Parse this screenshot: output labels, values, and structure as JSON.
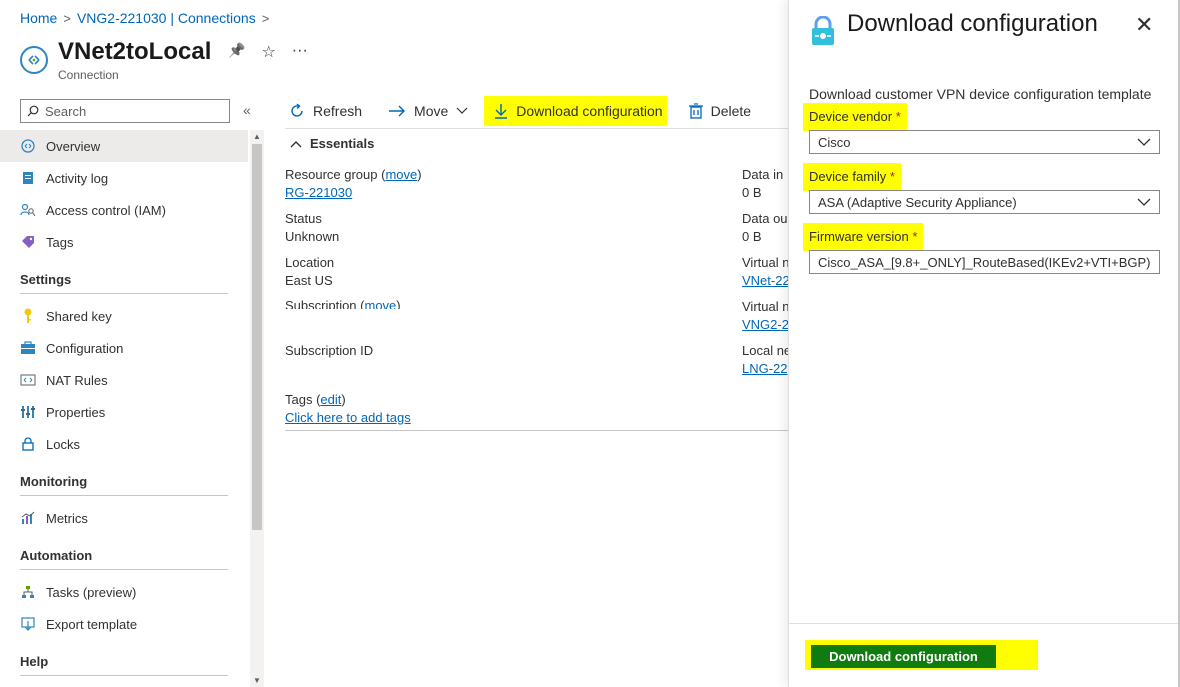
{
  "breadcrumb": {
    "home": "Home",
    "gateway": "VNG2-221030 | Connections",
    "sep": ">"
  },
  "header": {
    "title": "VNet2toLocal",
    "subtitle": "Connection",
    "pin": "📌",
    "star": "☆",
    "more": "···"
  },
  "search": {
    "placeholder": "Search",
    "collapse": "«"
  },
  "sidebar": {
    "items": [
      {
        "label": "Overview"
      },
      {
        "label": "Activity log"
      },
      {
        "label": "Access control (IAM)"
      },
      {
        "label": "Tags"
      }
    ],
    "settings": {
      "heading": "Settings",
      "items": [
        {
          "label": "Shared key"
        },
        {
          "label": "Configuration"
        },
        {
          "label": "NAT Rules"
        },
        {
          "label": "Properties"
        },
        {
          "label": "Locks"
        }
      ]
    },
    "monitoring": {
      "heading": "Monitoring",
      "items": [
        {
          "label": "Metrics"
        }
      ]
    },
    "automation": {
      "heading": "Automation",
      "items": [
        {
          "label": "Tasks (preview)"
        },
        {
          "label": "Export template"
        }
      ]
    },
    "help": {
      "heading": "Help"
    }
  },
  "toolbar": {
    "refresh": "Refresh",
    "move": "Move",
    "download": "Download configuration",
    "delete": "Delete"
  },
  "essentials": {
    "heading": "Essentials",
    "resource_group_label": "Resource group",
    "move_link": "move",
    "resource_group_value": "RG-221030",
    "status_label": "Status",
    "status_value": "Unknown",
    "location_label": "Location",
    "location_value": "East US",
    "subscription_label": "Subscription",
    "subscription_id_label": "Subscription ID",
    "tags_label": "Tags",
    "edit_link": "edit",
    "tags_add": "Click here to add tags",
    "data_in_label": "Data in",
    "data_in_value": "0 B",
    "data_out_label": "Data ou",
    "data_out_value": "0 B",
    "vnet_label": "Virtual n",
    "vnet_value": "VNet-22",
    "vng_label": "Virtual n",
    "vng_value": "VNG2-2",
    "lng_label": "Local ne",
    "lng_value": "LNG-22"
  },
  "panel": {
    "title": "Download configuration",
    "close": "✕",
    "description": "Download customer VPN device configuration template",
    "vendor_label": "Device vendor",
    "vendor_value": "Cisco",
    "family_label": "Device family",
    "family_value": "ASA (Adaptive Security Appliance)",
    "firmware_label": "Firmware version",
    "firmware_value": "Cisco_ASA_[9.8+_ONLY]_RouteBased(IKEv2+VTI+BGP)",
    "required_mark": "*",
    "download_button": "Download configuration"
  },
  "colors": {
    "accent": "#0067b8",
    "highlight": "#ffff00",
    "primary_button": "#107c10"
  }
}
